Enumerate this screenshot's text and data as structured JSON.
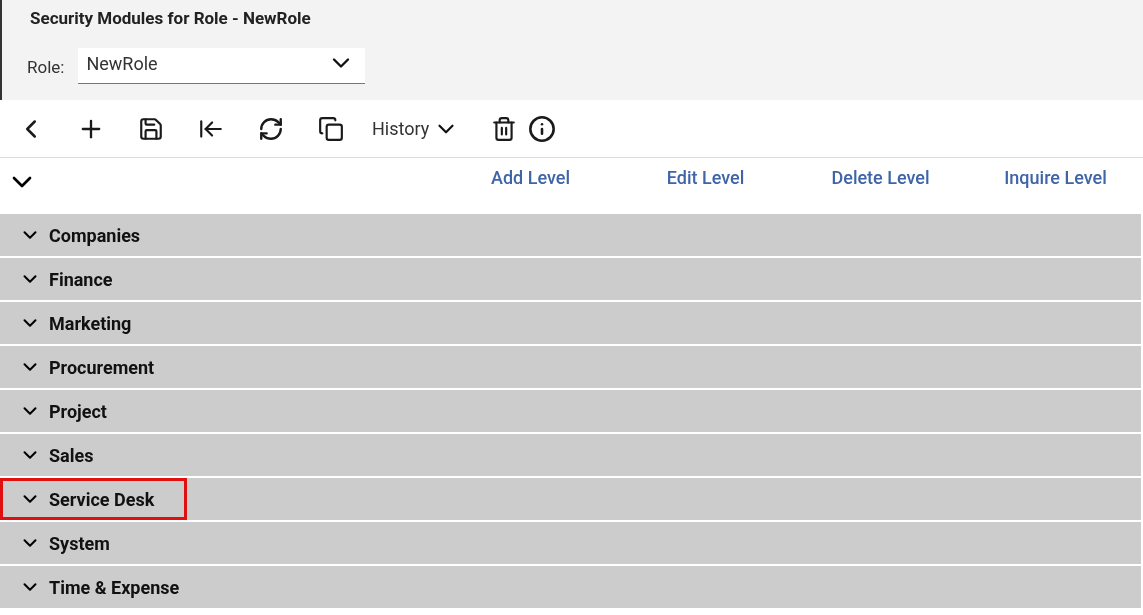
{
  "page_title": "Security Modules for Role - NewRole",
  "role_field": {
    "label": "Role:",
    "value": "NewRole"
  },
  "toolbar": {
    "history_label": "History"
  },
  "level_columns": [
    "Add Level",
    "Edit Level",
    "Delete Level",
    "Inquire Level"
  ],
  "modules": [
    {
      "label": "Companies",
      "expanded": false,
      "highlighted": false
    },
    {
      "label": "Finance",
      "expanded": false,
      "highlighted": false
    },
    {
      "label": "Marketing",
      "expanded": false,
      "highlighted": false
    },
    {
      "label": "Procurement",
      "expanded": false,
      "highlighted": false
    },
    {
      "label": "Project",
      "expanded": false,
      "highlighted": false
    },
    {
      "label": "Sales",
      "expanded": false,
      "highlighted": false
    },
    {
      "label": "Service Desk",
      "expanded": false,
      "highlighted": true
    },
    {
      "label": "System",
      "expanded": false,
      "highlighted": false
    },
    {
      "label": "Time & Expense",
      "expanded": false,
      "highlighted": false
    }
  ]
}
